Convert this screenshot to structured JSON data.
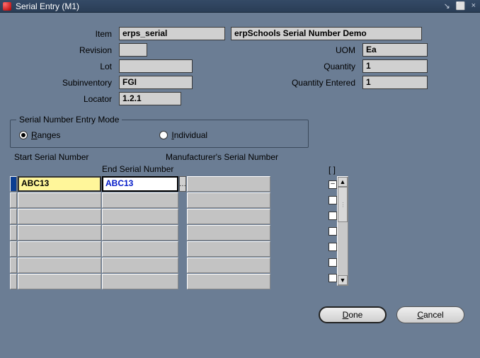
{
  "window": {
    "title": "Serial Entry (M1)"
  },
  "form": {
    "item_label": "Item",
    "item_value": "erps_serial",
    "item_desc": "erpSchools Serial Number Demo",
    "revision_label": "Revision",
    "revision_value": "",
    "uom_label": "UOM",
    "uom_value": "Ea",
    "lot_label": "Lot",
    "lot_value": "",
    "quantity_label": "Quantity",
    "quantity_value": "1",
    "subinventory_label": "Subinventory",
    "subinventory_value": "FGI",
    "quantity_entered_label": "Quantity Entered",
    "quantity_entered_value": "1",
    "locator_label": "Locator",
    "locator_value": "1.2.1"
  },
  "mode": {
    "legend": "Serial Number Entry Mode",
    "ranges": "Ranges",
    "ranges_hotkey": "R",
    "individual": "Individual",
    "individual_hotkey": "I",
    "selected": "Ranges"
  },
  "grid": {
    "start_header": "Start Serial Number",
    "end_header": "End Serial Number",
    "mfr_header": "Manufacturer's Serial Number",
    "check_header": "[ ]",
    "rows": [
      {
        "start": "ABC13",
        "end": "ABC13",
        "mfr": "",
        "checked": "dash"
      },
      {
        "start": "",
        "end": "",
        "mfr": "",
        "checked": ""
      },
      {
        "start": "",
        "end": "",
        "mfr": "",
        "checked": ""
      },
      {
        "start": "",
        "end": "",
        "mfr": "",
        "checked": ""
      },
      {
        "start": "",
        "end": "",
        "mfr": "",
        "checked": ""
      },
      {
        "start": "",
        "end": "",
        "mfr": "",
        "checked": ""
      },
      {
        "start": "",
        "end": "",
        "mfr": "",
        "checked": ""
      }
    ]
  },
  "buttons": {
    "done": "Done",
    "cancel": "Cancel",
    "done_hotkey": "D",
    "cancel_hotkey": "C"
  }
}
